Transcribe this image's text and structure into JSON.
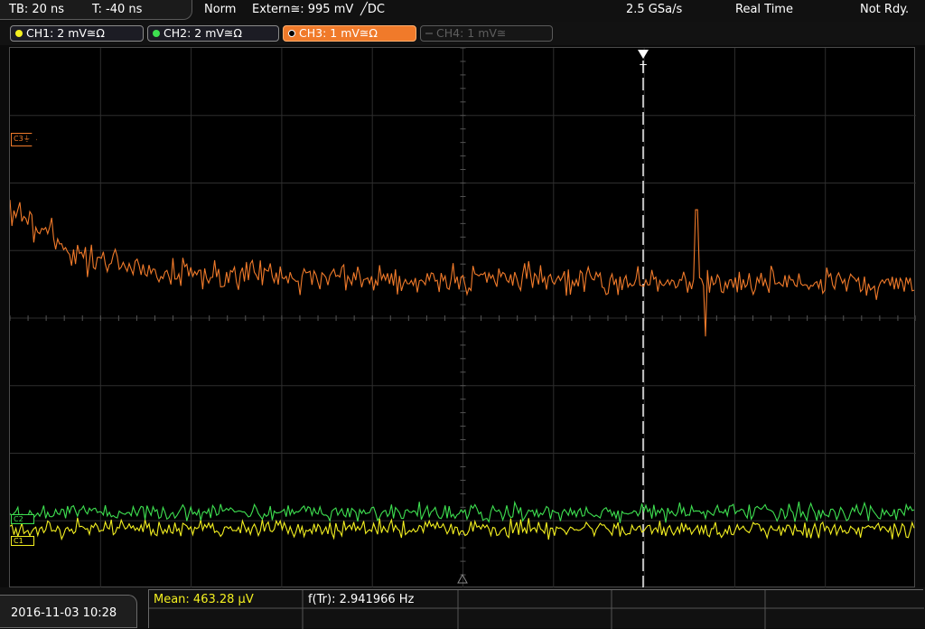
{
  "topbar": {
    "timebase": "TB: 20 ns",
    "trigger_time": "T: -40 ns",
    "mode": "Norm",
    "trigger_source": "Extern≅: 995 mV",
    "trigger_slope": "╱DC",
    "sample_rate": "2.5 GSa/s",
    "acq_mode": "Real Time",
    "status": "Not Rdy."
  },
  "channels": [
    {
      "label": "CH1: 2 mV≅Ω",
      "color": "#f4f020",
      "state": "on"
    },
    {
      "label": "CH2: 2 mV≅Ω",
      "color": "#3ee050",
      "state": "on"
    },
    {
      "label": "CH3: 1 mV≅Ω",
      "color": "#f07a2a",
      "state": "active"
    },
    {
      "label": "CH4: 1 mV≅",
      "color": "#5e5e5e",
      "state": "off"
    }
  ],
  "markers": {
    "ch3": "C3",
    "ch1": "C1",
    "ch2": "C2",
    "trigger": "T"
  },
  "colors": {
    "ch1": "#f4f020",
    "ch2": "#3ee050",
    "ch3": "#f07a2a",
    "grid": "#2e2e2e",
    "meas_label": "#f4f020"
  },
  "measurements": {
    "mean": "Mean: 463.28 µV",
    "freq": "f(Tr): 2.941966 Hz"
  },
  "datetime": "2016-11-03 10:28"
}
